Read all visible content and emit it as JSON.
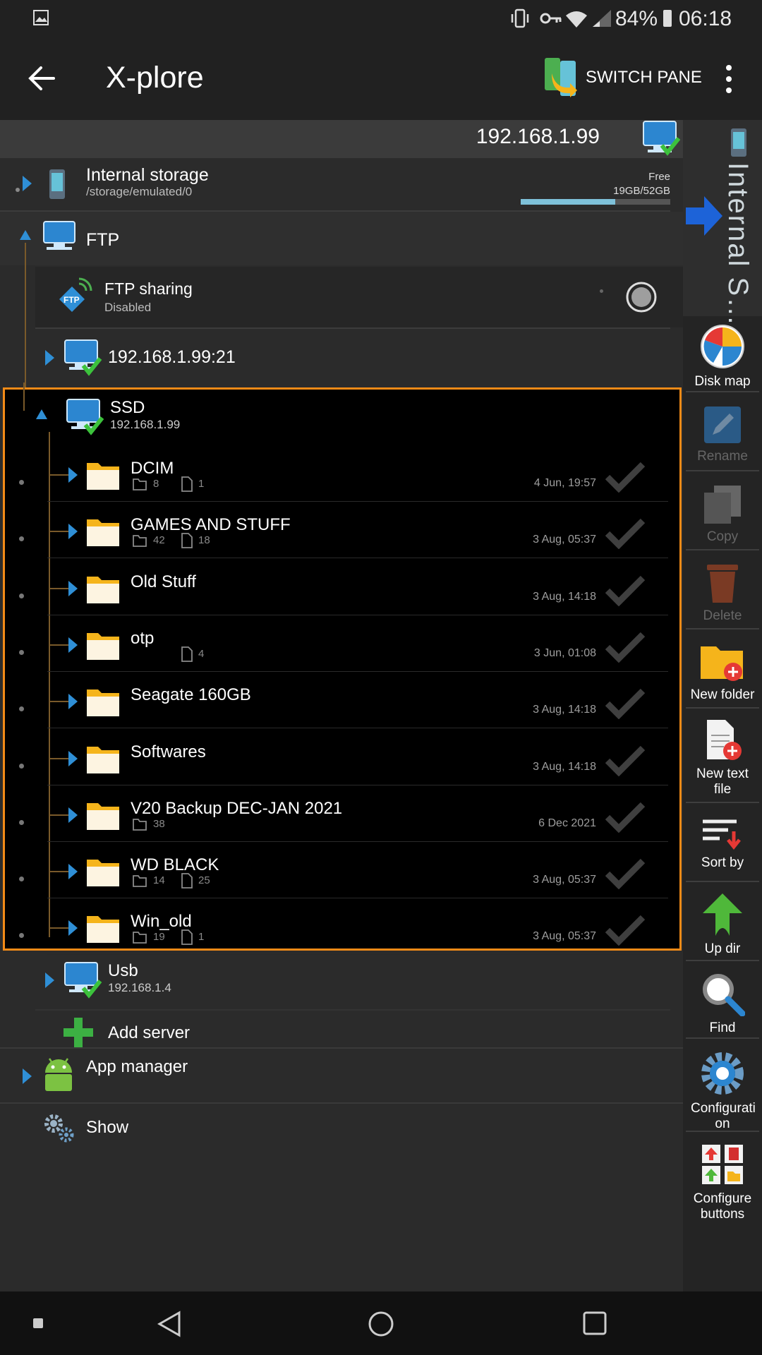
{
  "status": {
    "battery": "84%",
    "time": "06:18"
  },
  "appbar": {
    "title": "X-plore",
    "switch_pane": "SWITCH PANE"
  },
  "pathbar": {
    "ip": "192.168.1.99"
  },
  "right_pane_label": "Internal S…",
  "internal_storage": {
    "name": "Internal storage",
    "path": "/storage/emulated/0",
    "free_label": "Free",
    "size": "19GB/52GB",
    "used_fraction": 0.63
  },
  "ftp": {
    "label": "FTP",
    "sharing": "FTP sharing",
    "sharing_status": "Disabled",
    "server1": "192.168.1.99:21"
  },
  "ssd": {
    "name": "SSD",
    "ip": "192.168.1.99"
  },
  "folders": [
    {
      "name": "DCIM",
      "dirs": "8",
      "files": "1",
      "date": "4 Jun, 19:57"
    },
    {
      "name": "GAMES AND STUFF",
      "dirs": "42",
      "files": "18",
      "date": "3 Aug, 05:37"
    },
    {
      "name": "Old Stuff",
      "dirs": "",
      "files": "",
      "date": "3 Aug, 14:18"
    },
    {
      "name": "otp",
      "dirs": "",
      "files": "4",
      "date": "3 Jun, 01:08"
    },
    {
      "name": "Seagate 160GB",
      "dirs": "",
      "files": "",
      "date": "3 Aug, 14:18"
    },
    {
      "name": "Softwares",
      "dirs": "",
      "files": "",
      "date": "3 Aug, 14:18"
    },
    {
      "name": "V20 Backup DEC-JAN 2021",
      "dirs": "38",
      "files": "",
      "date": "6 Dec 2021"
    },
    {
      "name": "WD BLACK",
      "dirs": "14",
      "files": "25",
      "date": "3 Aug, 05:37"
    },
    {
      "name": "Win_old",
      "dirs": "19",
      "files": "1",
      "date": "3 Aug, 05:37"
    }
  ],
  "usb": {
    "name": "Usb",
    "ip": "192.168.1.4"
  },
  "add_server": "Add server",
  "app_manager": "App manager",
  "show": "Show",
  "sidebar": {
    "disk_map": "Disk map",
    "rename": "Rename",
    "copy": "Copy",
    "delete": "Delete",
    "new_folder": "New folder",
    "new_text_file": "New text file",
    "sort_by": "Sort by",
    "up_dir": "Up dir",
    "find": "Find",
    "configuration": "Configurati on",
    "configure_buttons": "Configure buttons"
  },
  "colors": {
    "accent": "#2f8fd6",
    "selection_border": "#f28a17",
    "folder": "#f5b41b"
  }
}
